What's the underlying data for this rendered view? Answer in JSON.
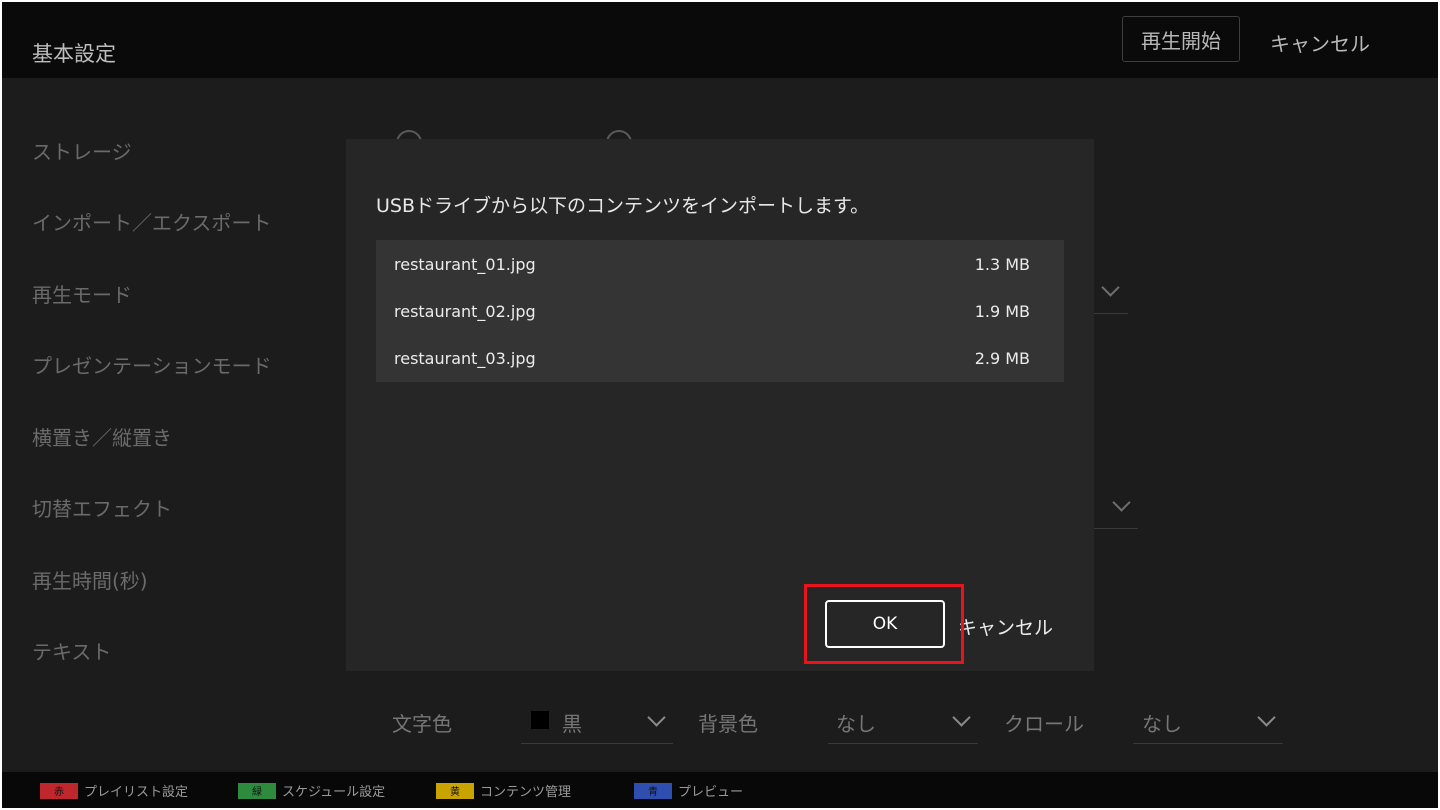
{
  "header": {
    "title": "基本設定",
    "start_button": "再生開始",
    "cancel_button": "キャンセル"
  },
  "settings_labels": [
    "ストレージ",
    "インポート／エクスポート",
    "再生モード",
    "プレゼンテーションモード",
    "横置き／縦置き",
    "切替エフェクト",
    "再生時間(秒)",
    "テキスト"
  ],
  "text_settings": {
    "font_color_label": "文字色",
    "font_color_value": "黒",
    "background_color_label": "背景色",
    "background_color_value": "なし",
    "scroll_label": "クロール",
    "scroll_value": "なし"
  },
  "footer": {
    "items": [
      {
        "badge": "赤",
        "label": "プレイリスト設定",
        "color": "#c0272d"
      },
      {
        "badge": "緑",
        "label": "スケジュール設定",
        "color": "#2e8b3e"
      },
      {
        "badge": "黄",
        "label": "コンテンツ管理",
        "color": "#c9a300"
      },
      {
        "badge": "青",
        "label": "プレビュー",
        "color": "#2f4fb0"
      }
    ]
  },
  "dialog": {
    "message": "USBドライブから以下のコンテンツをインポートします。",
    "files": [
      {
        "name": "restaurant_01.jpg",
        "size": "1.3 MB"
      },
      {
        "name": "restaurant_02.jpg",
        "size": "1.9 MB"
      },
      {
        "name": "restaurant_03.jpg",
        "size": "2.9 MB"
      }
    ],
    "ok_button": "OK",
    "cancel_button": "キャンセル"
  },
  "colors": {
    "highlight": "#e8141b",
    "background": "#1c1c1c",
    "dialog": "#262626"
  }
}
